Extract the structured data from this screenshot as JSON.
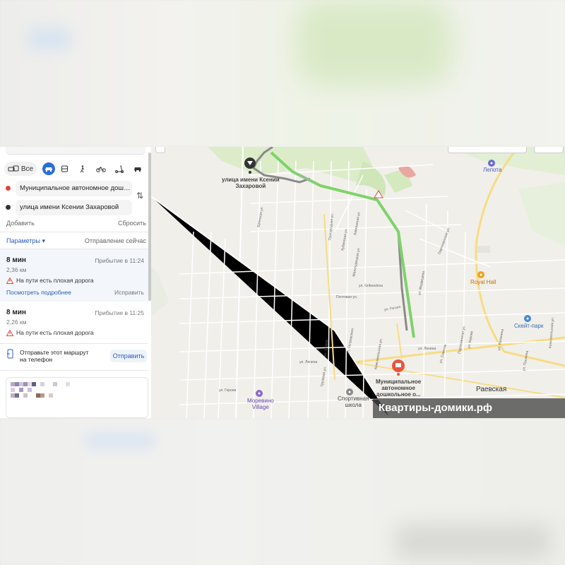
{
  "modes": {
    "all_label": "Все",
    "items": [
      "car-icon",
      "bus-icon",
      "walk-icon",
      "bike-icon",
      "scooter-icon",
      "taxi-icon"
    ]
  },
  "route": {
    "from": "Муниципальное автономное дошкольно...",
    "to": "улица имени Ксении Захаровой",
    "add_label": "Добавить",
    "reset_label": "Сбросить",
    "params_label": "Параметры ▾",
    "departure_label": "Отправление сейчас"
  },
  "options": [
    {
      "time": "8 мин",
      "arrival": "Прибытие в 11:24",
      "distance": "2,36 км",
      "warning": "На пути есть плохая дорога",
      "details_label": "Посмотреть подробнее",
      "edit_label": "Исправить"
    },
    {
      "time": "8 мин",
      "arrival": "Прибытие в 11:25",
      "distance": "2,26 км",
      "warning": "На пути есть плохая дорога"
    }
  ],
  "send": {
    "text_line1": "Отправьте этот маршрут",
    "text_line2": "на телефон",
    "button": "Отправить"
  },
  "map": {
    "start_label_line1": "улица имени Ксении",
    "start_label_line2": "Захаровой",
    "dest_label_line1": "Муниципальное",
    "dest_label_line2": "автономное",
    "dest_label_line3": "дошкольное о...",
    "places": {
      "lepota": "Лепота",
      "royal_hall": "Royal Hall",
      "skate_park": "Скейт-парк",
      "raevskaya": "Раевская",
      "morevino_line1": "Моревино",
      "morevino_line2": "Village",
      "sport_school_line1": "Спортивная",
      "sport_school_line2": "школа"
    },
    "streets": {
      "griboedova": "ул. Griboedova",
      "pochtovaya": "Почтовая ул.",
      "lenina": "ул. Ленина",
      "lenina2": "ул. Ленина",
      "geroev": "ул. Героев",
      "gogolya": "ул. Гоголя",
      "medvedeva": "ул. Медведева",
      "kubanskaya": "Кубанская ул.",
      "prigorodnaya": "Пригородная ул.",
      "partizanskaya": "Партизанская ул.",
      "bryanskaya": "Брянская ул.",
      "maloturskaya": "Малотурецкая ул.",
      "kavkazskaya": "Кавказская ул.",
      "kosmicheskaya": "Комсомольская ул.",
      "sovetov": "ул. Советов",
      "kirova": "ул. Кирова",
      "ostrovskogo": "ул. Островского",
      "shirta": "ул. Щорса",
      "gruzovaya": "Грузовая ул.",
      "partizanskaya2": "Партизанская ул.",
      "pushkina": "ул. Пушкина",
      "kalinina": "ул. Калинина",
      "komsomolskaya2": "Комсомольская ул."
    }
  },
  "watermark": "Квартиры-домики.рф",
  "colors": {
    "accent": "#2b6fd6",
    "route": "#7ed36a",
    "route_alt": "#8a8a8a",
    "warning": "#e0433a"
  }
}
